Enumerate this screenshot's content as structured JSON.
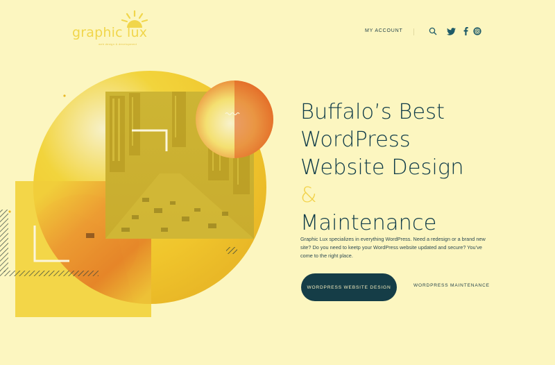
{
  "brand": {
    "name": "graphic lux",
    "tagline": "web design & development"
  },
  "nav": {
    "account_label": "MY ACCOUNT",
    "icons": [
      "search-icon",
      "twitter-icon",
      "facebook-icon",
      "instagram-icon"
    ]
  },
  "hero": {
    "headline": [
      "Buffalo’s Best",
      "WordPress",
      "Website Design",
      "&",
      "Maintenance"
    ],
    "description": "Graphic Lux specializes in everything WordPress. Need a redesign or a brand new site? Do you need to keetp your WordPress website updated and secure? You’ve come to the right place.",
    "primary_button": "WORDPRESS WEBSITE DESIGN",
    "secondary_button": "WORDPRESS MAINTENANCE"
  },
  "colors": {
    "background": "#fcf6c0",
    "accent_yellow": "#f2d24a",
    "accent_orange": "#e0591c",
    "dark_teal": "#153d47"
  }
}
